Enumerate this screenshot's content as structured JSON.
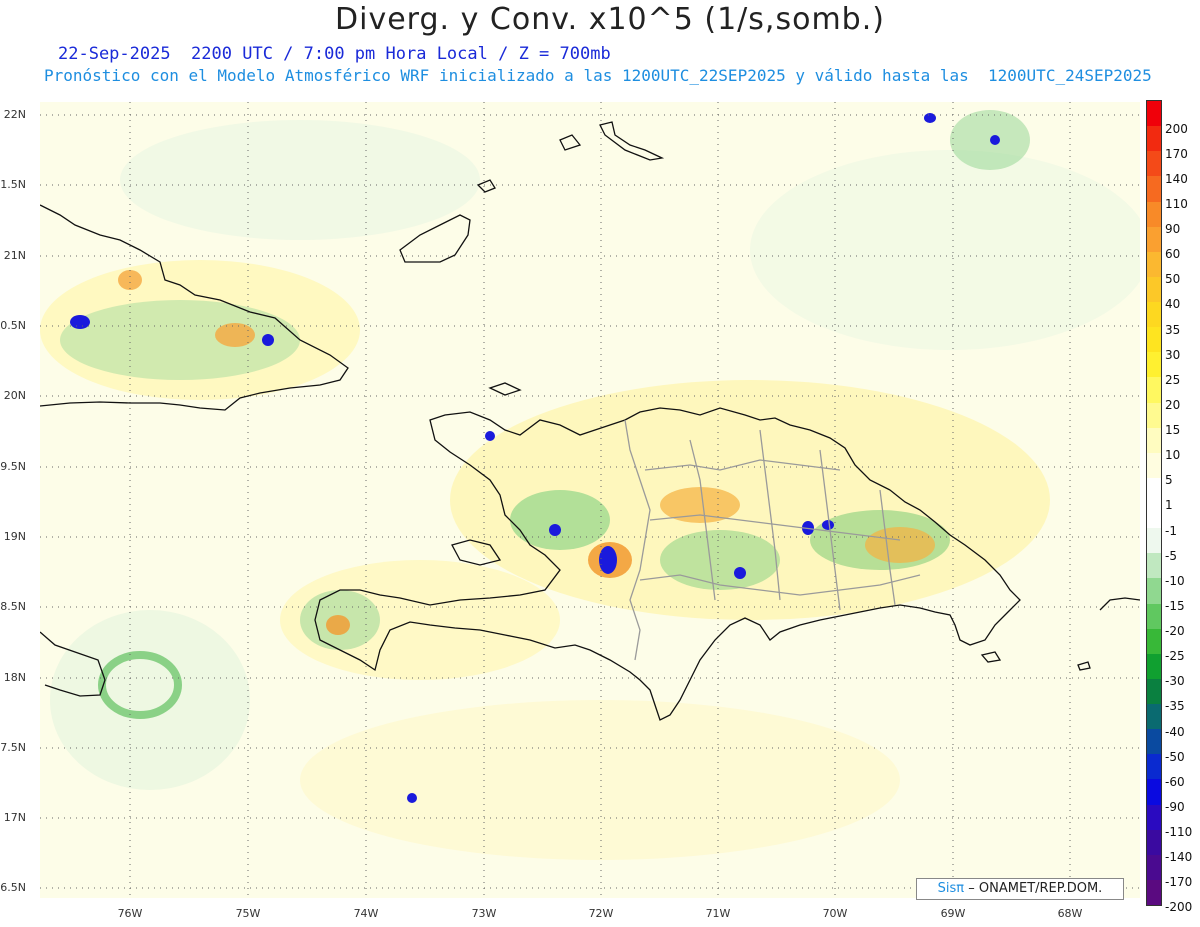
{
  "header": {
    "title": "Diverg. y Conv. x10^5 (1/s,somb.)",
    "line1": "22-Sep-2025  2200 UTC / 7:00 pm Hora Local / Z = 700mb",
    "line2": "Pronóstico con el Modelo Atmosférico WRF inicializado a las 1200UTC_22SEP2025 y válido hasta las  1200UTC_24SEP2025"
  },
  "map": {
    "lat_labels": [
      "22N",
      "1.5N",
      "21N",
      "0.5N",
      "20N",
      "9.5N",
      "19N",
      "8.5N",
      "18N",
      "7.5N",
      "17N",
      "6.5N"
    ],
    "lon_labels": [
      "76W",
      "75W",
      "74W",
      "73W",
      "72W",
      "71W",
      "70W",
      "69W",
      "68W"
    ]
  },
  "colorbar": {
    "labels": [
      "200",
      "170",
      "140",
      "110",
      "90",
      "60",
      "50",
      "40",
      "35",
      "30",
      "25",
      "20",
      "15",
      "10",
      "5",
      "1",
      "-1",
      "-5",
      "-10",
      "-15",
      "-20",
      "-25",
      "-30",
      "-35",
      "-40",
      "-50",
      "-60",
      "-90",
      "-110",
      "-140",
      "-170",
      "-200"
    ],
    "colors": [
      "#f0000a",
      "#f22a10",
      "#f44a18",
      "#f66a20",
      "#f88a28",
      "#faa030",
      "#fbb830",
      "#fcc828",
      "#fdd820",
      "#fee420",
      "#fff030",
      "#fff860",
      "#fffa90",
      "#fffcc0",
      "#fffde0",
      "#ffffff",
      "#ffffff",
      "#eef8ee",
      "#c0e8c0",
      "#90d890",
      "#60c860",
      "#38b838",
      "#10a030",
      "#0a8040",
      "#0a6a70",
      "#0a4aa0",
      "#0a2ad0",
      "#0a0ae0",
      "#2a0ac0",
      "#3a0aa0",
      "#4a0a90",
      "#5a0a80"
    ]
  },
  "credit": {
    "logo": "Sisπ",
    "text": "– ONAMET/REP.DOM."
  }
}
